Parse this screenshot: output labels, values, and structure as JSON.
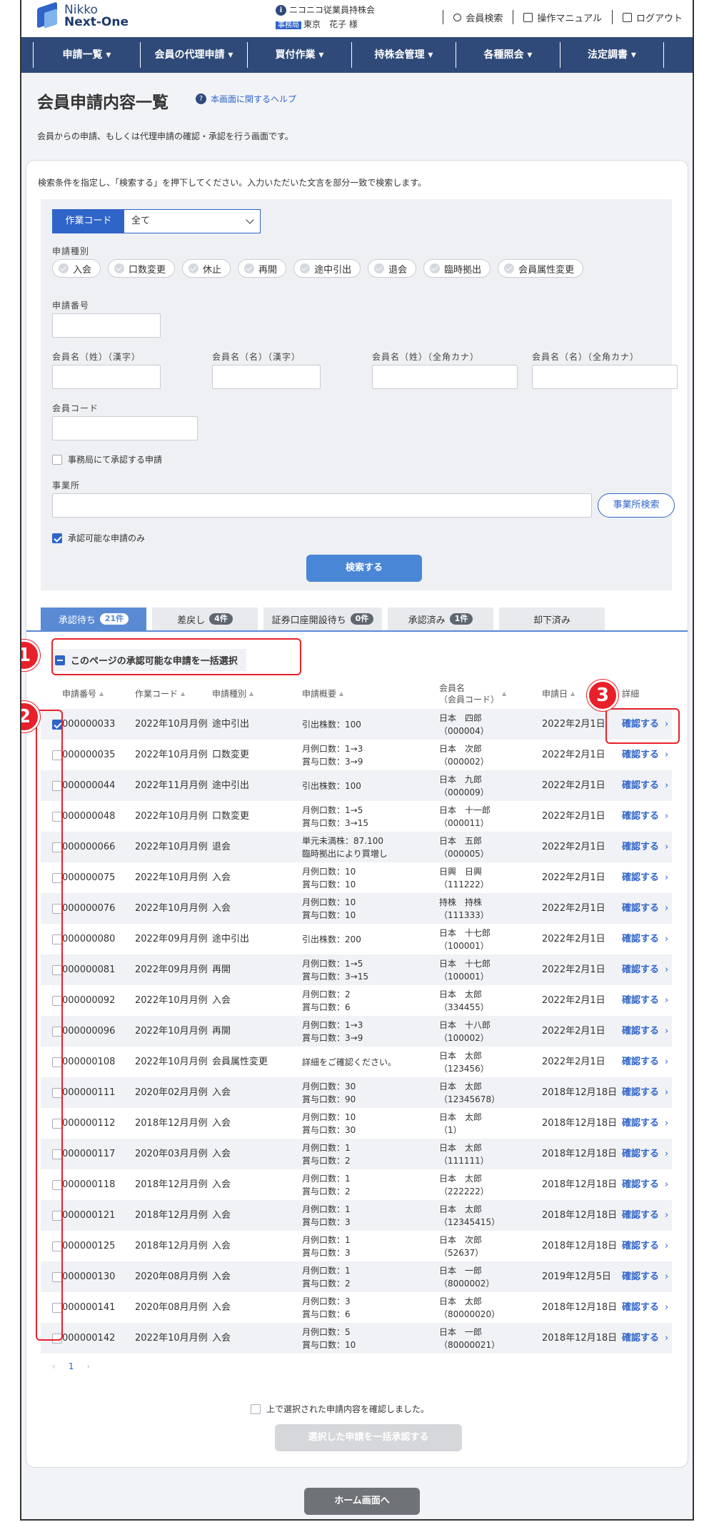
{
  "header": {
    "logo_line1": "Nikko",
    "logo_line2": "Next-One",
    "org_name": "ニコニコ従業員持株会",
    "office_badge": "事務局",
    "user_name": "東京　花子 様",
    "links": {
      "member_search": "会員検索",
      "manual": "操作マニュアル",
      "logout": "ログアウト"
    }
  },
  "nav": [
    {
      "label": "申請一覧 ▾"
    },
    {
      "label": "会員の代理申請 ▾"
    },
    {
      "label": "買付作業 ▾"
    },
    {
      "label": "持株会管理 ▾"
    },
    {
      "label": "各種照会 ▾"
    },
    {
      "label": "法定調書 ▾"
    }
  ],
  "page": {
    "title": "会員申請内容一覧",
    "help_link": "本画面に関するヘルプ",
    "description": "会員からの申請、もしくは代理申請の確認・承認を行う画面です。"
  },
  "search": {
    "hint": "検索条件を指定し、「検索する」を押下してください。入力いただいた文言を部分一致で検索します。",
    "work_code_label": "作業コード",
    "work_code_value": "全て",
    "app_type_label": "申請種別",
    "app_types": [
      "入会",
      "口数変更",
      "休止",
      "再開",
      "途中引出",
      "退会",
      "臨時拠出",
      "会員属性変更"
    ],
    "app_number_label": "申請番号",
    "last_kanji_label": "会員名（姓）（漢字）",
    "first_kanji_label": "会員名（名）（漢字）",
    "last_kana_label": "会員名（姓）（全角カナ）",
    "first_kana_label": "会員名（名）（全角カナ）",
    "member_code_label": "会員コード",
    "office_approve_label": "事務局にて承認する申請",
    "office_label": "事業所",
    "office_search_button": "事業所検索",
    "approvable_only_label": "承認可能な申請のみ",
    "approvable_only_checked": true,
    "search_button": "検索する"
  },
  "tabs": [
    {
      "label": "承認待ち",
      "count": "21件",
      "active": true
    },
    {
      "label": "差戻し",
      "count": "4件",
      "active": false
    },
    {
      "label": "証券口座開設待ち",
      "count": "0件",
      "active": false
    },
    {
      "label": "承認済み",
      "count": "1件",
      "active": false
    },
    {
      "label": "却下済み",
      "count": "",
      "active": false
    }
  ],
  "bulk_select_label": "このページの承認可能な申請を一括選択",
  "table": {
    "columns": [
      "申請番号",
      "作業コード",
      "申請種別",
      "申請概要",
      "会員名\n（会員コード）",
      "申請日",
      "詳細"
    ],
    "detail_label": "確認する",
    "rows": [
      {
        "checked": true,
        "no": "000000033",
        "code": "2022年10月月例",
        "kind": "途中引出",
        "sum1": "引出株数：100",
        "sum2": "",
        "name": "日本　四郎",
        "mcode": "（000004）",
        "date": "2022年2月1日"
      },
      {
        "checked": false,
        "no": "000000035",
        "code": "2022年10月月例",
        "kind": "口数変更",
        "sum1": "月例口数：1→3",
        "sum2": "賞与口数：3→9",
        "name": "日本　次郎",
        "mcode": "（000002）",
        "date": "2022年2月1日"
      },
      {
        "checked": false,
        "no": "000000044",
        "code": "2022年11月月例",
        "kind": "途中引出",
        "sum1": "引出株数：100",
        "sum2": "",
        "name": "日本　九郎",
        "mcode": "（000009）",
        "date": "2022年2月1日"
      },
      {
        "checked": false,
        "no": "000000048",
        "code": "2022年10月月例",
        "kind": "口数変更",
        "sum1": "月例口数：1→5",
        "sum2": "賞与口数：3→15",
        "name": "日本　十一郎",
        "mcode": "（000011）",
        "date": "2022年2月1日"
      },
      {
        "checked": false,
        "no": "000000066",
        "code": "2022年10月月例",
        "kind": "退会",
        "sum1": "単元未満株：87.100",
        "sum2": "臨時拠出により買増し",
        "name": "日本　五郎",
        "mcode": "（000005）",
        "date": "2022年2月1日"
      },
      {
        "checked": false,
        "no": "000000075",
        "code": "2022年10月月例",
        "kind": "入会",
        "sum1": "月例口数：10",
        "sum2": "賞与口数：10",
        "name": "日興　日興",
        "mcode": "（111222）",
        "date": "2022年2月1日"
      },
      {
        "checked": false,
        "no": "000000076",
        "code": "2022年10月月例",
        "kind": "入会",
        "sum1": "月例口数：10",
        "sum2": "賞与口数：10",
        "name": "持株　持株",
        "mcode": "（111333）",
        "date": "2022年2月1日"
      },
      {
        "checked": false,
        "no": "000000080",
        "code": "2022年09月月例",
        "kind": "途中引出",
        "sum1": "引出株数：200",
        "sum2": "",
        "name": "日本　十七郎",
        "mcode": "（100001）",
        "date": "2022年2月1日"
      },
      {
        "checked": false,
        "no": "000000081",
        "code": "2022年09月月例",
        "kind": "再開",
        "sum1": "月例口数：1→5",
        "sum2": "賞与口数：3→15",
        "name": "日本　十七郎",
        "mcode": "（100001）",
        "date": "2022年2月1日"
      },
      {
        "checked": false,
        "no": "000000092",
        "code": "2022年10月月例",
        "kind": "入会",
        "sum1": "月例口数：2",
        "sum2": "賞与口数：6",
        "name": "日本　太郎",
        "mcode": "（334455）",
        "date": "2022年2月1日"
      },
      {
        "checked": false,
        "no": "000000096",
        "code": "2022年10月月例",
        "kind": "再開",
        "sum1": "月例口数：1→3",
        "sum2": "賞与口数：3→9",
        "name": "日本　十八郎",
        "mcode": "（100002）",
        "date": "2022年2月1日"
      },
      {
        "checked": false,
        "no": "000000108",
        "code": "2022年10月月例",
        "kind": "会員属性変更",
        "sum1": "詳細をご確認ください。",
        "sum2": "",
        "name": "日本　太郎",
        "mcode": "（123456）",
        "date": "2022年2月1日"
      },
      {
        "checked": false,
        "no": "000000111",
        "code": "2020年02月月例",
        "kind": "入会",
        "sum1": "月例口数：30",
        "sum2": "賞与口数：90",
        "name": "日本　太郎",
        "mcode": "（12345678）",
        "date": "2018年12月18日"
      },
      {
        "checked": false,
        "no": "000000112",
        "code": "2018年12月月例",
        "kind": "入会",
        "sum1": "月例口数：10",
        "sum2": "賞与口数：30",
        "name": "日本　太郎",
        "mcode": "（1）",
        "date": "2018年12月18日"
      },
      {
        "checked": false,
        "no": "000000117",
        "code": "2020年03月月例",
        "kind": "入会",
        "sum1": "月例口数：1",
        "sum2": "賞与口数：2",
        "name": "日本　太郎",
        "mcode": "（111111）",
        "date": "2018年12月18日"
      },
      {
        "checked": false,
        "no": "000000118",
        "code": "2018年12月月例",
        "kind": "入会",
        "sum1": "月例口数：1",
        "sum2": "賞与口数：2",
        "name": "日本　太郎",
        "mcode": "（222222）",
        "date": "2018年12月18日"
      },
      {
        "checked": false,
        "no": "000000121",
        "code": "2018年12月月例",
        "kind": "入会",
        "sum1": "月例口数：1",
        "sum2": "賞与口数：3",
        "name": "日本　太郎",
        "mcode": "（12345415）",
        "date": "2018年12月18日"
      },
      {
        "checked": false,
        "no": "000000125",
        "code": "2018年12月月例",
        "kind": "入会",
        "sum1": "月例口数：1",
        "sum2": "賞与口数：3",
        "name": "日本　次郎",
        "mcode": "（52637）",
        "date": "2018年12月18日"
      },
      {
        "checked": false,
        "no": "000000130",
        "code": "2020年08月月例",
        "kind": "入会",
        "sum1": "月例口数：1",
        "sum2": "賞与口数：2",
        "name": "日本　一郎",
        "mcode": "（8000002）",
        "date": "2019年12月5日"
      },
      {
        "checked": false,
        "no": "000000141",
        "code": "2020年08月月例",
        "kind": "入会",
        "sum1": "月例口数：3",
        "sum2": "賞与口数：6",
        "name": "日本　太郎",
        "mcode": "（80000020）",
        "date": "2018年12月18日"
      },
      {
        "checked": false,
        "no": "000000142",
        "code": "2022年10月月例",
        "kind": "入会",
        "sum1": "月例口数：5",
        "sum2": "賞与口数：10",
        "name": "日本　一郎",
        "mcode": "（80000021）",
        "date": "2018年12月18日"
      }
    ]
  },
  "pager": {
    "prev": "‹",
    "current": "1",
    "next": "›"
  },
  "confirm_label": "上で選択された申請内容を確認しました。",
  "approve_button": "選択した申請を一括承認する",
  "home_button": "ホーム画面へ",
  "annotations": [
    "1",
    "2",
    "3"
  ],
  "colors": {
    "accent": "#2f64c9",
    "nav": "#2f4a78",
    "annotation": "#e8202a"
  }
}
